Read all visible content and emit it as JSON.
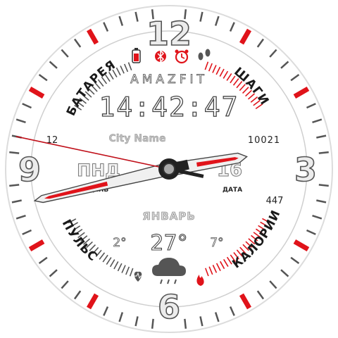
{
  "brand": "AMAZFIT",
  "time": {
    "hours": "14",
    "minutes": "42",
    "seconds": "47",
    "display": "14:42:47"
  },
  "hours_numerals": {
    "twelve": "12",
    "three": "3",
    "six": "6",
    "nine": "9"
  },
  "arc_labels": {
    "battery": "БАТАРЕЯ",
    "steps": "ШАГИ",
    "pulse": "ПУЛЬС",
    "calories": "КАЛОРИИ"
  },
  "values": {
    "battery": "12",
    "steps": "10021",
    "pulse": "",
    "calories": "447"
  },
  "city": "City Name",
  "day_name": "ПНД",
  "day_label": "ДЕНЬ",
  "date": "16",
  "date_label": "ДАТА",
  "month": "ЯНВАРЬ",
  "weather": {
    "current": "27°",
    "low": "2°",
    "high": "7°",
    "icon": "cloud-rain-icon"
  },
  "status_icons": [
    "battery-icon",
    "bluetooth-icon",
    "alarm-icon",
    "steps-icon"
  ],
  "bottom_icons": [
    "heart-icon",
    "flame-icon"
  ],
  "hands": {
    "hour": 14.7,
    "minute": 42.78,
    "second": 47
  },
  "colors": {
    "accent": "#e0131a",
    "dark": "#1a1a1a",
    "silver": "#c8c8c8"
  }
}
